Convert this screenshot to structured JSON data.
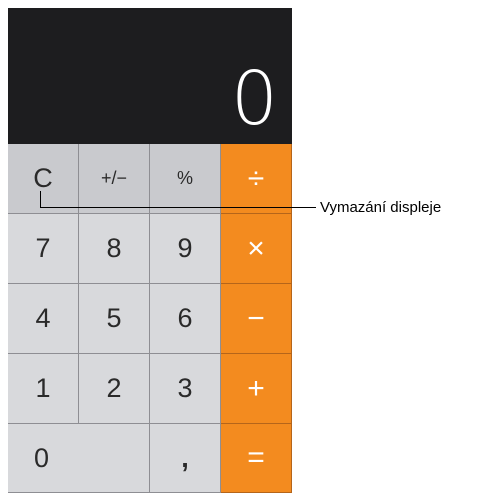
{
  "display": {
    "value": "0"
  },
  "keys": {
    "clear": "C",
    "plus_minus": "+/−",
    "percent": "%",
    "divide": "÷",
    "seven": "7",
    "eight": "8",
    "nine": "9",
    "multiply": "×",
    "four": "4",
    "five": "5",
    "six": "6",
    "minus": "−",
    "one": "1",
    "two": "2",
    "three": "3",
    "plus": "+",
    "zero": "0",
    "decimal": ",",
    "equals": "="
  },
  "callout": {
    "label": "Vymazání displeje"
  },
  "colors": {
    "display_bg": "#1d1d1f",
    "operator_bg": "#f38b1f",
    "number_bg": "#d8d9dc",
    "function_bg": "#c9cace"
  }
}
